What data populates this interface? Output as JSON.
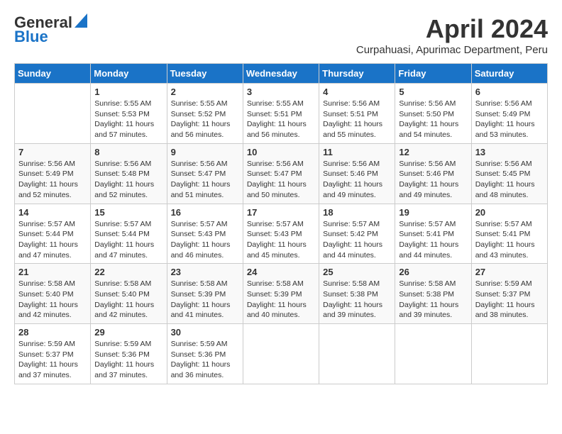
{
  "logo": {
    "line1": "General",
    "line2": "Blue"
  },
  "title": "April 2024",
  "subtitle": "Curpahuasi, Apurimac Department, Peru",
  "days_of_week": [
    "Sunday",
    "Monday",
    "Tuesday",
    "Wednesday",
    "Thursday",
    "Friday",
    "Saturday"
  ],
  "weeks": [
    [
      {
        "day": "",
        "sunrise": "",
        "sunset": "",
        "daylight": ""
      },
      {
        "day": "1",
        "sunrise": "Sunrise: 5:55 AM",
        "sunset": "Sunset: 5:53 PM",
        "daylight": "Daylight: 11 hours and 57 minutes."
      },
      {
        "day": "2",
        "sunrise": "Sunrise: 5:55 AM",
        "sunset": "Sunset: 5:52 PM",
        "daylight": "Daylight: 11 hours and 56 minutes."
      },
      {
        "day": "3",
        "sunrise": "Sunrise: 5:55 AM",
        "sunset": "Sunset: 5:51 PM",
        "daylight": "Daylight: 11 hours and 56 minutes."
      },
      {
        "day": "4",
        "sunrise": "Sunrise: 5:56 AM",
        "sunset": "Sunset: 5:51 PM",
        "daylight": "Daylight: 11 hours and 55 minutes."
      },
      {
        "day": "5",
        "sunrise": "Sunrise: 5:56 AM",
        "sunset": "Sunset: 5:50 PM",
        "daylight": "Daylight: 11 hours and 54 minutes."
      },
      {
        "day": "6",
        "sunrise": "Sunrise: 5:56 AM",
        "sunset": "Sunset: 5:49 PM",
        "daylight": "Daylight: 11 hours and 53 minutes."
      }
    ],
    [
      {
        "day": "7",
        "sunrise": "Sunrise: 5:56 AM",
        "sunset": "Sunset: 5:49 PM",
        "daylight": "Daylight: 11 hours and 52 minutes."
      },
      {
        "day": "8",
        "sunrise": "Sunrise: 5:56 AM",
        "sunset": "Sunset: 5:48 PM",
        "daylight": "Daylight: 11 hours and 52 minutes."
      },
      {
        "day": "9",
        "sunrise": "Sunrise: 5:56 AM",
        "sunset": "Sunset: 5:47 PM",
        "daylight": "Daylight: 11 hours and 51 minutes."
      },
      {
        "day": "10",
        "sunrise": "Sunrise: 5:56 AM",
        "sunset": "Sunset: 5:47 PM",
        "daylight": "Daylight: 11 hours and 50 minutes."
      },
      {
        "day": "11",
        "sunrise": "Sunrise: 5:56 AM",
        "sunset": "Sunset: 5:46 PM",
        "daylight": "Daylight: 11 hours and 49 minutes."
      },
      {
        "day": "12",
        "sunrise": "Sunrise: 5:56 AM",
        "sunset": "Sunset: 5:46 PM",
        "daylight": "Daylight: 11 hours and 49 minutes."
      },
      {
        "day": "13",
        "sunrise": "Sunrise: 5:56 AM",
        "sunset": "Sunset: 5:45 PM",
        "daylight": "Daylight: 11 hours and 48 minutes."
      }
    ],
    [
      {
        "day": "14",
        "sunrise": "Sunrise: 5:57 AM",
        "sunset": "Sunset: 5:44 PM",
        "daylight": "Daylight: 11 hours and 47 minutes."
      },
      {
        "day": "15",
        "sunrise": "Sunrise: 5:57 AM",
        "sunset": "Sunset: 5:44 PM",
        "daylight": "Daylight: 11 hours and 47 minutes."
      },
      {
        "day": "16",
        "sunrise": "Sunrise: 5:57 AM",
        "sunset": "Sunset: 5:43 PM",
        "daylight": "Daylight: 11 hours and 46 minutes."
      },
      {
        "day": "17",
        "sunrise": "Sunrise: 5:57 AM",
        "sunset": "Sunset: 5:43 PM",
        "daylight": "Daylight: 11 hours and 45 minutes."
      },
      {
        "day": "18",
        "sunrise": "Sunrise: 5:57 AM",
        "sunset": "Sunset: 5:42 PM",
        "daylight": "Daylight: 11 hours and 44 minutes."
      },
      {
        "day": "19",
        "sunrise": "Sunrise: 5:57 AM",
        "sunset": "Sunset: 5:41 PM",
        "daylight": "Daylight: 11 hours and 44 minutes."
      },
      {
        "day": "20",
        "sunrise": "Sunrise: 5:57 AM",
        "sunset": "Sunset: 5:41 PM",
        "daylight": "Daylight: 11 hours and 43 minutes."
      }
    ],
    [
      {
        "day": "21",
        "sunrise": "Sunrise: 5:58 AM",
        "sunset": "Sunset: 5:40 PM",
        "daylight": "Daylight: 11 hours and 42 minutes."
      },
      {
        "day": "22",
        "sunrise": "Sunrise: 5:58 AM",
        "sunset": "Sunset: 5:40 PM",
        "daylight": "Daylight: 11 hours and 42 minutes."
      },
      {
        "day": "23",
        "sunrise": "Sunrise: 5:58 AM",
        "sunset": "Sunset: 5:39 PM",
        "daylight": "Daylight: 11 hours and 41 minutes."
      },
      {
        "day": "24",
        "sunrise": "Sunrise: 5:58 AM",
        "sunset": "Sunset: 5:39 PM",
        "daylight": "Daylight: 11 hours and 40 minutes."
      },
      {
        "day": "25",
        "sunrise": "Sunrise: 5:58 AM",
        "sunset": "Sunset: 5:38 PM",
        "daylight": "Daylight: 11 hours and 39 minutes."
      },
      {
        "day": "26",
        "sunrise": "Sunrise: 5:58 AM",
        "sunset": "Sunset: 5:38 PM",
        "daylight": "Daylight: 11 hours and 39 minutes."
      },
      {
        "day": "27",
        "sunrise": "Sunrise: 5:59 AM",
        "sunset": "Sunset: 5:37 PM",
        "daylight": "Daylight: 11 hours and 38 minutes."
      }
    ],
    [
      {
        "day": "28",
        "sunrise": "Sunrise: 5:59 AM",
        "sunset": "Sunset: 5:37 PM",
        "daylight": "Daylight: 11 hours and 37 minutes."
      },
      {
        "day": "29",
        "sunrise": "Sunrise: 5:59 AM",
        "sunset": "Sunset: 5:36 PM",
        "daylight": "Daylight: 11 hours and 37 minutes."
      },
      {
        "day": "30",
        "sunrise": "Sunrise: 5:59 AM",
        "sunset": "Sunset: 5:36 PM",
        "daylight": "Daylight: 11 hours and 36 minutes."
      },
      {
        "day": "",
        "sunrise": "",
        "sunset": "",
        "daylight": ""
      },
      {
        "day": "",
        "sunrise": "",
        "sunset": "",
        "daylight": ""
      },
      {
        "day": "",
        "sunrise": "",
        "sunset": "",
        "daylight": ""
      },
      {
        "day": "",
        "sunrise": "",
        "sunset": "",
        "daylight": ""
      }
    ]
  ]
}
